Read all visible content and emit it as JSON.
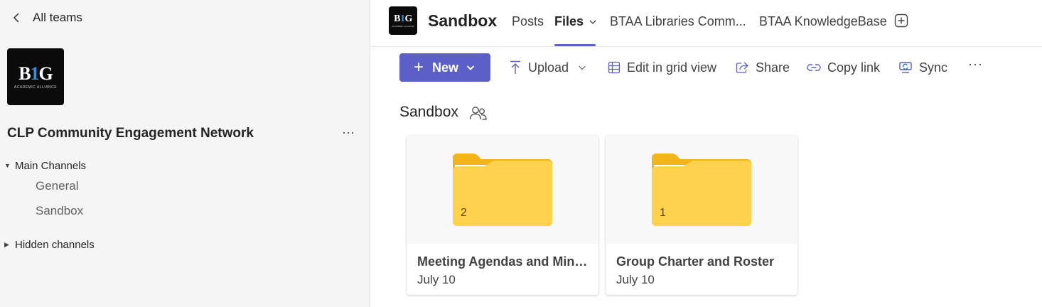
{
  "sidebar": {
    "back_label": "All teams",
    "team_logo_text": "B1G",
    "team_logo_sub": "ACADEMIC ALLIANCE",
    "team_name": "CLP Community Engagement Network",
    "more_label": "···",
    "main_channels_label": "Main Channels",
    "channels": [
      "General",
      "Sandbox"
    ],
    "hidden_channels_label": "Hidden channels"
  },
  "header": {
    "channel_title": "Sandbox",
    "tabs": [
      {
        "label": "Posts",
        "active": false
      },
      {
        "label": "Files",
        "active": true
      },
      {
        "label": "BTAA Libraries Comm...",
        "active": false
      },
      {
        "label": "BTAA KnowledgeBase",
        "active": false
      }
    ]
  },
  "toolbar": {
    "new_label": "New",
    "upload_label": "Upload",
    "grid_label": "Edit in grid view",
    "share_label": "Share",
    "copy_link_label": "Copy link",
    "sync_label": "Sync",
    "more_label": "···"
  },
  "library": {
    "title": "Sandbox",
    "folders": [
      {
        "name": "Meeting Agendas and Minu...",
        "date": "July 10",
        "count": "2"
      },
      {
        "name": "Group Charter and Roster",
        "date": "July 10",
        "count": "1"
      }
    ]
  },
  "colors": {
    "accent": "#5b5fc7",
    "sidebar_bg": "#f5f5f5",
    "folder_front": "#ffd24d",
    "folder_back": "#f2b519"
  },
  "icons": [
    "chevron-left-icon",
    "more-icon",
    "caret-down-icon",
    "caret-right-icon",
    "add-tab-icon",
    "plus-icon",
    "upload-icon",
    "grid-icon",
    "share-icon",
    "link-icon",
    "sync-icon",
    "shared-people-icon",
    "folder-icon"
  ]
}
